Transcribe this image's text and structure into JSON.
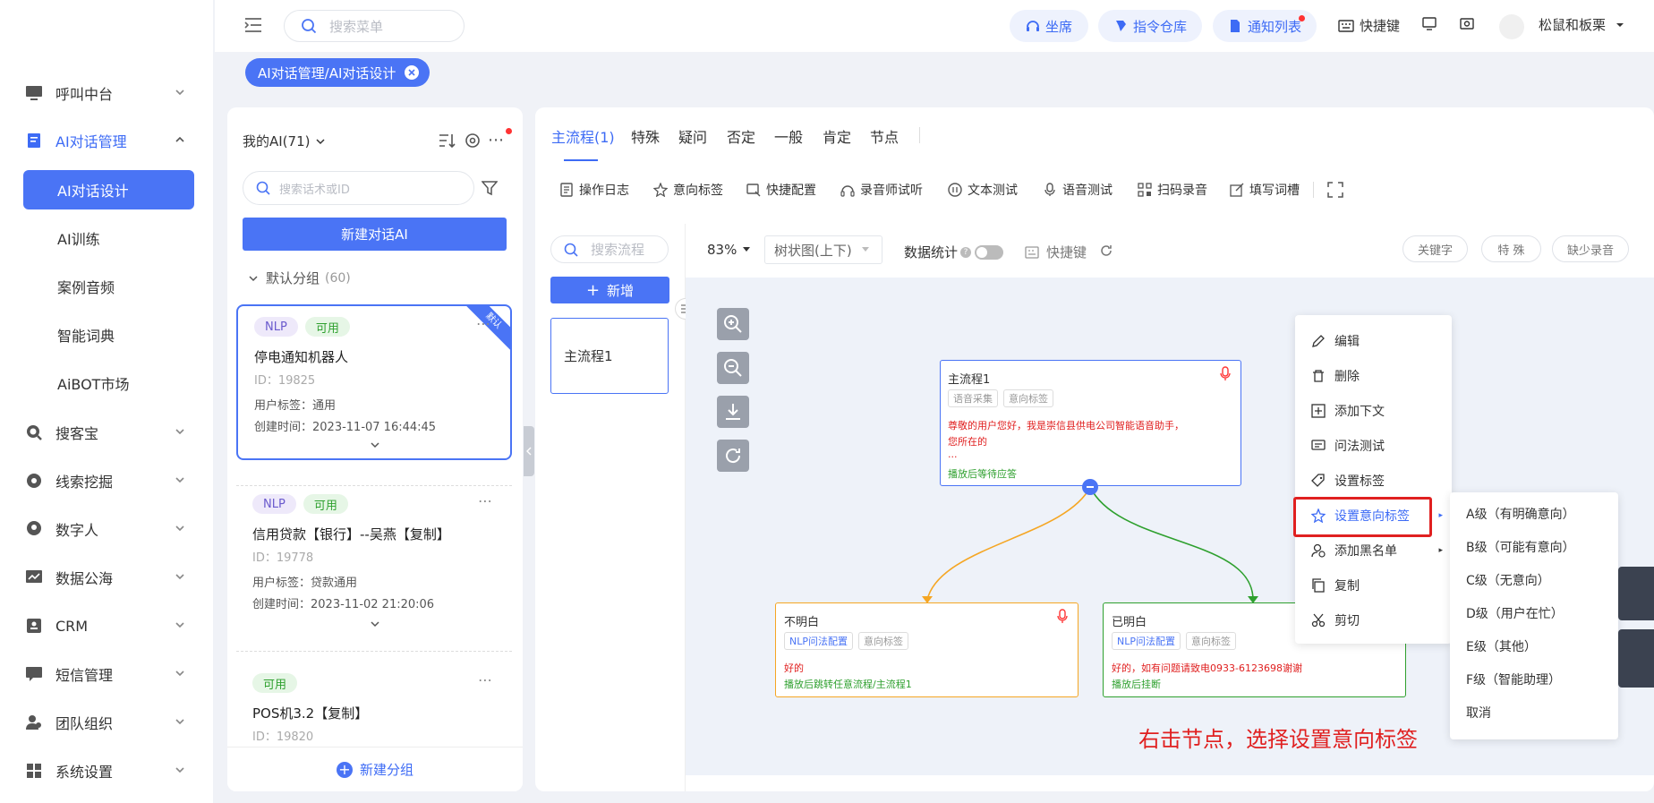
{
  "sidebar": {
    "items": [
      {
        "label": "呼叫中台",
        "icon": "monitor-icon"
      },
      {
        "label": "AI对话管理",
        "icon": "book-icon"
      },
      {
        "label": "搜客宝",
        "icon": "search-zoom-icon"
      },
      {
        "label": "线索挖掘",
        "icon": "dial-icon"
      },
      {
        "label": "数字人",
        "icon": "digital-human-icon"
      },
      {
        "label": "数据公海",
        "icon": "chart-icon"
      },
      {
        "label": "CRM",
        "icon": "crm-icon"
      },
      {
        "label": "短信管理",
        "icon": "message-icon"
      },
      {
        "label": "团队组织",
        "icon": "team-icon"
      },
      {
        "label": "系统设置",
        "icon": "grid-icon"
      }
    ],
    "sub_items": [
      "AI对话设计",
      "AI训练",
      "案例音频",
      "智能词典",
      "AiBOT市场"
    ]
  },
  "topbar": {
    "search_placeholder": "搜索菜单",
    "seat": "坐席",
    "command_repo": "指令仓库",
    "notice_list": "通知列表",
    "shortcut": "快捷键",
    "user": "松鼠和板栗"
  },
  "breadcrumb_tag": "AI对话管理/AI对话设计",
  "left_panel": {
    "title": "我的AI(71)",
    "search_placeholder": "搜索话术或ID",
    "new_ai_button": "新建对话AI",
    "group_label": "默认分组",
    "group_count": "(60)",
    "default_ribbon": "默认",
    "new_group": "新建分组",
    "cards": [
      {
        "tags": [
          "NLP",
          "可用"
        ],
        "name": "停电通知机器人",
        "id": "ID：19825",
        "user_tag": "用户标签：通用",
        "created": "创建时间：2023-11-07 16:44:45"
      },
      {
        "tags": [
          "NLP",
          "可用"
        ],
        "name": "信用贷款【银行】--吴燕【复制】",
        "id": "ID：19778",
        "user_tag": "用户标签：贷款通用",
        "created": "创建时间：2023-11-02 21:20:06"
      },
      {
        "tags": [
          "可用"
        ],
        "name": "POS机3.2【复制】",
        "id": "ID：19820"
      }
    ]
  },
  "tabs": [
    "主流程(1)",
    "特殊",
    "疑问",
    "否定",
    "一般",
    "肯定",
    "节点"
  ],
  "toolbar": [
    "操作日志",
    "意向标签",
    "快捷配置",
    "录音师试听",
    "文本测试",
    "语音测试",
    "扫码录音",
    "填写词槽"
  ],
  "flow_panel": {
    "search_placeholder": "搜索流程",
    "add_button": "新增",
    "flow_item": "主流程1"
  },
  "canvas_bar": {
    "zoom": "83%",
    "view_mode": "树状图(上下)",
    "data_stats": "数据统计",
    "shortcut": "快捷键",
    "keyword": "关键字",
    "special": "特 殊",
    "missing_audio": "缺少录音"
  },
  "nodes": {
    "main": {
      "title": "主流程1",
      "chips": [
        "语音采集",
        "意向标签"
      ],
      "text1": "尊敬的用户您好，我是崇信县供电公司智能语音助手，",
      "text2": "您所在的",
      "text3": "...",
      "action": "播放后等待应答"
    },
    "left": {
      "title": "不明白",
      "chips": [
        "NLP问法配置",
        "意向标签"
      ],
      "text": "好的",
      "action": "播放后跳转任意流程/主流程1"
    },
    "right": {
      "title": "已明白",
      "chips": [
        "NLP问法配置",
        "意向标签"
      ],
      "text": "好的，如有问题请致电0933-6123698谢谢",
      "action": "播放后挂断"
    }
  },
  "context_menu": [
    "编辑",
    "删除",
    "添加下文",
    "问法测试",
    "设置标签",
    "设置意向标签",
    "添加黑名单",
    "复制",
    "剪切"
  ],
  "intent_submenu": [
    "A级（有明确意向）",
    "B级（可能有意向）",
    "C级（无意向）",
    "D级（用户在忙）",
    "E级（其他）",
    "F级（智能助理）",
    "取消"
  ],
  "annotation": "右击节点，选择设置意向标签",
  "colors": {
    "primary": "#4a74f5",
    "highlight": "#e02020",
    "orange": "#f5a623",
    "green": "#2ea02e"
  }
}
